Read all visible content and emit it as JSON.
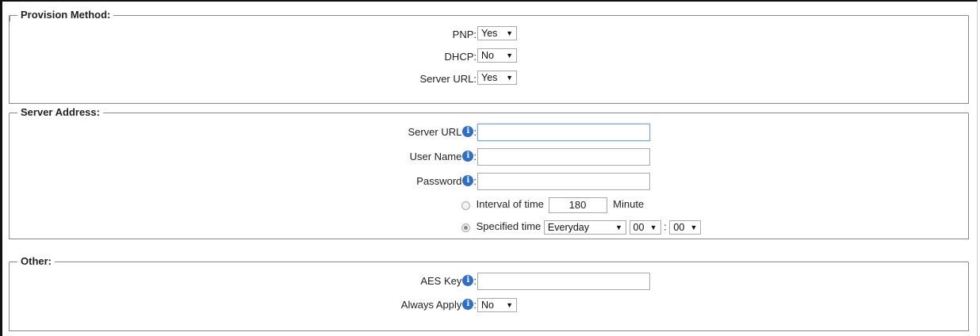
{
  "provision": {
    "legend": "Provision Method:",
    "pnp": {
      "label": "PNP:",
      "value": "Yes"
    },
    "dhcp": {
      "label": "DHCP:",
      "value": "No"
    },
    "server_url": {
      "label": "Server URL:",
      "value": "Yes"
    }
  },
  "server": {
    "legend": "Server Address:",
    "url": {
      "label": "Server URL",
      "sep": ":",
      "value": ""
    },
    "username": {
      "label": "User Name",
      "sep": ":",
      "value": ""
    },
    "password": {
      "label": "Password",
      "sep": ":",
      "value": ""
    },
    "interval": {
      "label": "Interval of time",
      "value": "180",
      "unit": "Minute",
      "selected": false
    },
    "specified": {
      "label": "Specified time",
      "period": "Everyday",
      "hour": "00",
      "colon": ":",
      "minute": "00",
      "selected": true
    }
  },
  "other": {
    "legend": "Other:",
    "aes": {
      "label": "AES Key",
      "sep": ":",
      "value": ""
    },
    "always_apply": {
      "label": "Always Apply",
      "sep": ":",
      "value": "No"
    }
  },
  "icons": {
    "info": "info-icon",
    "dropdown": "chevron-down-icon"
  },
  "colors": {
    "info": "#2f6fc8",
    "focus_border": "#7aa7e0"
  }
}
